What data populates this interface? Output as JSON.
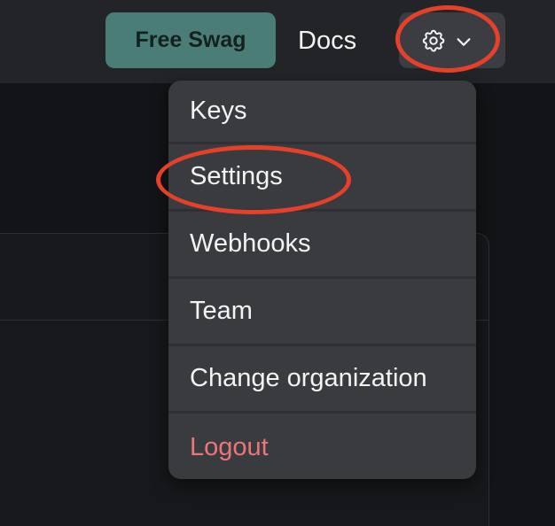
{
  "header": {
    "swag_label": "Free Swag",
    "docs_label": "Docs",
    "settings_toggle": {
      "icon": "gear-icon",
      "chevron": "chevron-down-icon",
      "expanded": true
    }
  },
  "dropdown": {
    "items": [
      {
        "label": "Keys"
      },
      {
        "label": "Settings"
      },
      {
        "label": "Webhooks"
      },
      {
        "label": "Team"
      },
      {
        "label": "Change organization"
      },
      {
        "label": "Logout"
      }
    ]
  },
  "colors": {
    "accent_button": "#4a7d78",
    "logout_text": "#e9777a",
    "annotation": "#e5402a",
    "menu_bg": "#3a3b3f",
    "topbar_bg": "#222428"
  }
}
